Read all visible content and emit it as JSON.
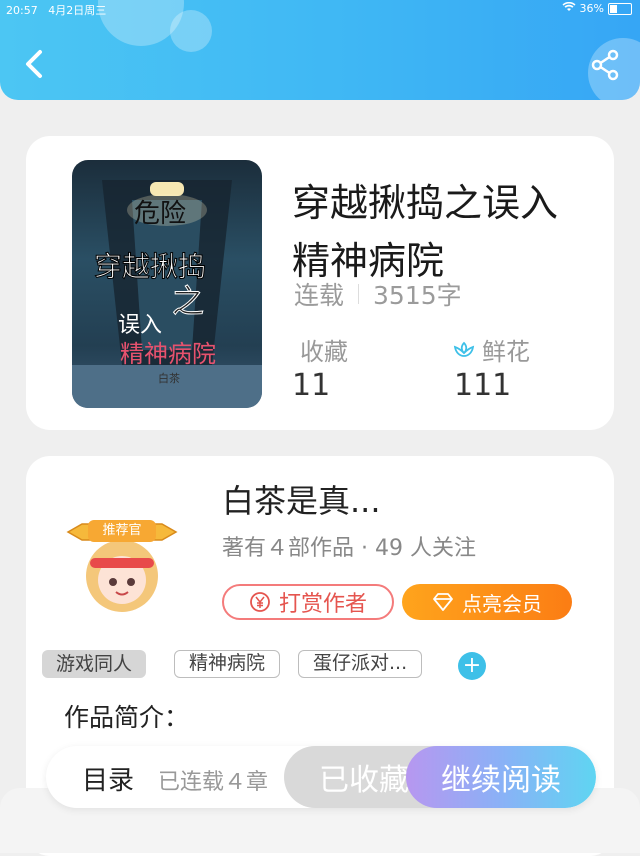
{
  "status_bar": {
    "time": "20:57",
    "date": "4月2日周三",
    "battery": "36%"
  },
  "header": {
    "back_icon": "chevron-left-icon",
    "share_icon": "share-icon"
  },
  "book": {
    "title": "穿越揪捣之误入精神病院",
    "status": "连载",
    "word_count": "3515字",
    "favorites_label": "收藏",
    "favorites_value": "11",
    "flowers_label": "鲜花",
    "flowers_value": "111",
    "cover": {
      "line1": "危险",
      "line2": "穿越揪捣",
      "line3": "之",
      "line4": "误入",
      "line5": "精神病院",
      "author_mark": "白茶"
    }
  },
  "author": {
    "name": "白茶是真...",
    "works_info": "著有４部作品 · 49 人关注",
    "badge": "推荐官",
    "tip_button": "打赏作者",
    "vip_button": "点亮会员"
  },
  "tags": [
    "游戏同人",
    "精神病院",
    "蛋仔派对..."
  ],
  "intro": {
    "label": "作品简介：",
    "text": ""
  },
  "bottom_bar": {
    "toc_label": "目录",
    "toc_sub": "已连载４章",
    "collected_label": "已收藏",
    "continue_label": "继续阅读"
  },
  "colors": {
    "header": "#3fb7f4",
    "accent_orange": "#fb7d14",
    "tip_red": "#e5554f"
  }
}
